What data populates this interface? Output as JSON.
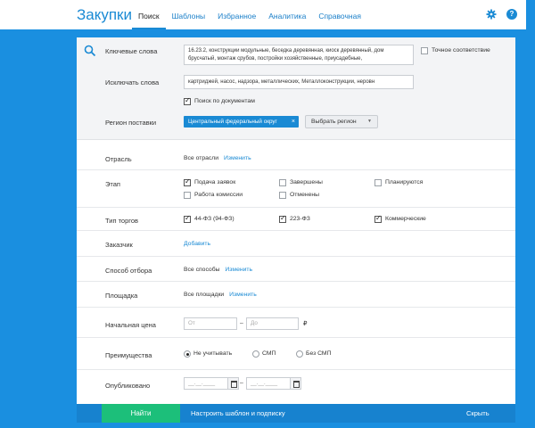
{
  "header": {
    "app_title": "Закупки",
    "nav": [
      "Поиск",
      "Шаблоны",
      "Избранное",
      "Аналитика",
      "Справочная"
    ],
    "help_glyph": "?"
  },
  "keywords": {
    "label": "Ключевые слова",
    "value": "16.23.2, конструкции модульные, беседка деревянная, киоск деревянный, дом брусчатый, монтаж срубов, постройки хозяйственные, приусадебные,",
    "exact_match_label": "Точное соответствие",
    "exact_match_checked": false
  },
  "exclude": {
    "label": "Исключать слова",
    "value": "картриджей, насос, надзора, металлических, Металлоконструкции, неровн",
    "doc_search_label": "Поиск по документам",
    "doc_search_checked": true
  },
  "region": {
    "label": "Регион поставки",
    "selected_tag": "Центральный федеральный округ",
    "tag_remove": "×",
    "choose_button": "Выбрать регион",
    "caret": "▼"
  },
  "industry": {
    "label": "Отрасль",
    "value": "Все отрасли",
    "link": "Изменить"
  },
  "stage": {
    "label": "Этап",
    "options": [
      {
        "label": "Подача заявок",
        "checked": true
      },
      {
        "label": "Завершены",
        "checked": false
      },
      {
        "label": "Планируются",
        "checked": false
      },
      {
        "label": "Работа комиссии",
        "checked": false
      },
      {
        "label": "Отменены",
        "checked": false
      }
    ]
  },
  "trade_type": {
    "label": "Тип торгов",
    "options": [
      {
        "label": "44-ФЗ (94-ФЗ)",
        "checked": true
      },
      {
        "label": "223-ФЗ",
        "checked": true
      },
      {
        "label": "Коммерческие",
        "checked": true
      }
    ]
  },
  "customer": {
    "label": "Заказчик",
    "link": "Добавить"
  },
  "selection": {
    "label": "Способ отбора",
    "value": "Все способы",
    "link": "Изменить"
  },
  "platform": {
    "label": "Площадка",
    "value": "Все площадки",
    "link": "Изменить"
  },
  "price": {
    "label": "Начальная цена",
    "from_placeholder": "От",
    "to_placeholder": "До",
    "dash": "–",
    "currency": "₽"
  },
  "advantages": {
    "label": "Преимущества",
    "options": [
      {
        "label": "Не учитывать",
        "selected": true
      },
      {
        "label": "СМП",
        "selected": false
      },
      {
        "label": "Без СМП",
        "selected": false
      }
    ]
  },
  "published": {
    "label": "Опубликовано",
    "from_placeholder": "__.__.____",
    "to_placeholder": "__.__.____",
    "dash": "–"
  },
  "footer": {
    "find_button": "Найти",
    "template_link": "Настроить шаблон и подписку",
    "hide_link": "Скрыть"
  },
  "colors": {
    "accent": "#1a8ad4",
    "background": "#1a8fe0",
    "find_button": "#1cbf7a"
  }
}
